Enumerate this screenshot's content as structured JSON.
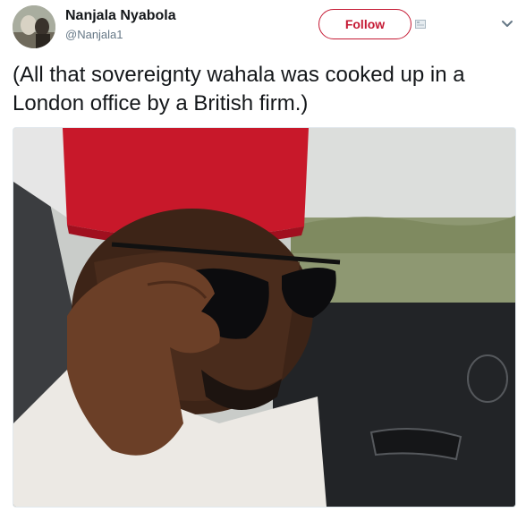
{
  "author": {
    "display_name": "Nanjala Nyabola",
    "handle": "@Nanjala1",
    "avatar_icon": "user-avatar"
  },
  "actions": {
    "follow_label": "Follow"
  },
  "tweet": {
    "text": "(All that sovereignty wahala was cooked up in a London office by a British firm.)"
  },
  "media": {
    "description_icon": "photo"
  },
  "colors": {
    "follow_accent": "#c51a34",
    "handle_gray": "#657786",
    "text_dark": "#14171a"
  }
}
